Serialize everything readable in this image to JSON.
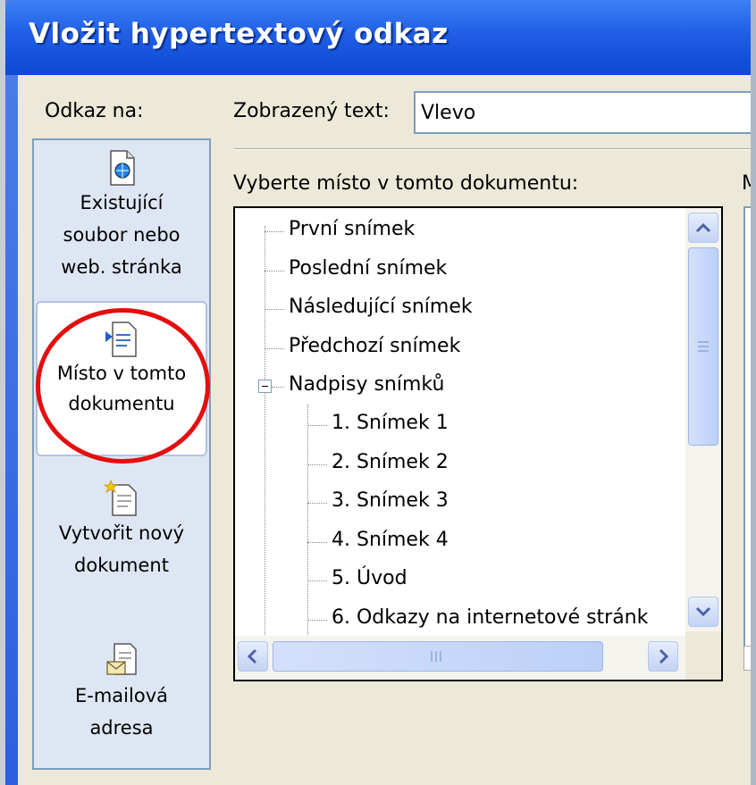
{
  "window": {
    "title": "Vložit hypertextový odkaz"
  },
  "left": {
    "label": "Odkaz na:",
    "items": [
      {
        "line1": "Existující",
        "line2": "soubor nebo",
        "line3": "web. stránka",
        "icon": "file-globe-icon"
      },
      {
        "line1": "Místo v tomto",
        "line2": "dokumentu",
        "icon": "document-place-icon",
        "selected": true
      },
      {
        "line1": "Vytvořit nový",
        "line2": "dokument",
        "icon": "new-document-icon"
      },
      {
        "line1": "E-mailová",
        "line2": "adresa",
        "icon": "email-icon"
      }
    ]
  },
  "display": {
    "label": "Zobrazený text:",
    "value": "Vlevo"
  },
  "tree": {
    "label": "Vyberte místo v tomto dokumentu:",
    "items": [
      "První snímek",
      "Poslední snímek",
      "Následující snímek",
      "Předchozí snímek",
      "Nadpisy snímků",
      "1. Snímek 1",
      "2. Snímek 2",
      "3. Snímek 3",
      "4. Snímek 4",
      "5. Úvod",
      "6. Odkazy na internetové stránk"
    ]
  },
  "cut_label": "M",
  "colors": {
    "title_bar": "#1f5ee5",
    "highlight_circle": "#e30f0f",
    "panel": "#ece9d8"
  }
}
